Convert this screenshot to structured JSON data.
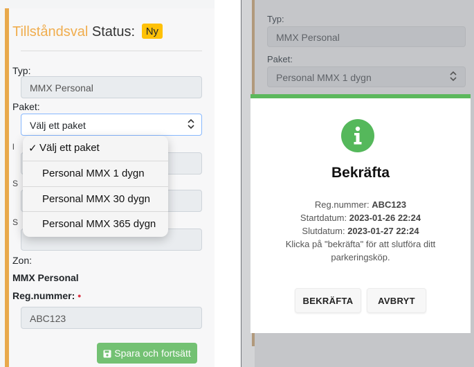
{
  "left": {
    "title_part1": "Tillståndsval",
    "title_part2": "Status:",
    "status_badge": "Ny",
    "typ_label": "Typ:",
    "typ_value": "MMX Personal",
    "paket_label": "Paket:",
    "paket_selected": "Välj ett paket",
    "dropdown_options": [
      {
        "label": "Välj ett paket",
        "checked": true
      },
      {
        "label": "Personal MMX 1 dygn",
        "checked": false
      },
      {
        "label": "Personal MMX 30 dygn",
        "checked": false
      },
      {
        "label": "Personal MMX 365 dygn",
        "checked": false
      }
    ],
    "check_mark": "✓",
    "zon_label": "Zon:",
    "zon_value": "MMX Personal",
    "reg_label": "Reg.nummer:",
    "required_mark": "•",
    "reg_value": "ABC123",
    "save_label": "Spara och fortsätt"
  },
  "right": {
    "typ_label": "Typ:",
    "typ_value": "MMX Personal",
    "paket_label": "Paket:",
    "paket_value": "Personal MMX 1 dygn",
    "modal": {
      "title": "Bekräfta",
      "reg_label": "Reg.nummer:",
      "reg_value": "ABC123",
      "start_label": "Startdatum:",
      "start_value": "2023-01-26 22:24",
      "end_label": "Slutdatum:",
      "end_value": "2023-01-27 22:24",
      "message_line1": "Klicka på \"bekräfta\" för att slutföra ditt",
      "message_line2": "parkeringsköp.",
      "confirm_label": "BEKRÄFTA",
      "cancel_label": "AVBRYT"
    }
  },
  "colors": {
    "accent_orange": "#f0ad4e",
    "badge_yellow": "#ffc107",
    "success_green": "#5cb85c",
    "required_red": "#dc3545"
  },
  "icons": {
    "select_chevron": "up-down-chevron-icon",
    "save": "floppy-disk-icon",
    "modal": "info-icon"
  }
}
